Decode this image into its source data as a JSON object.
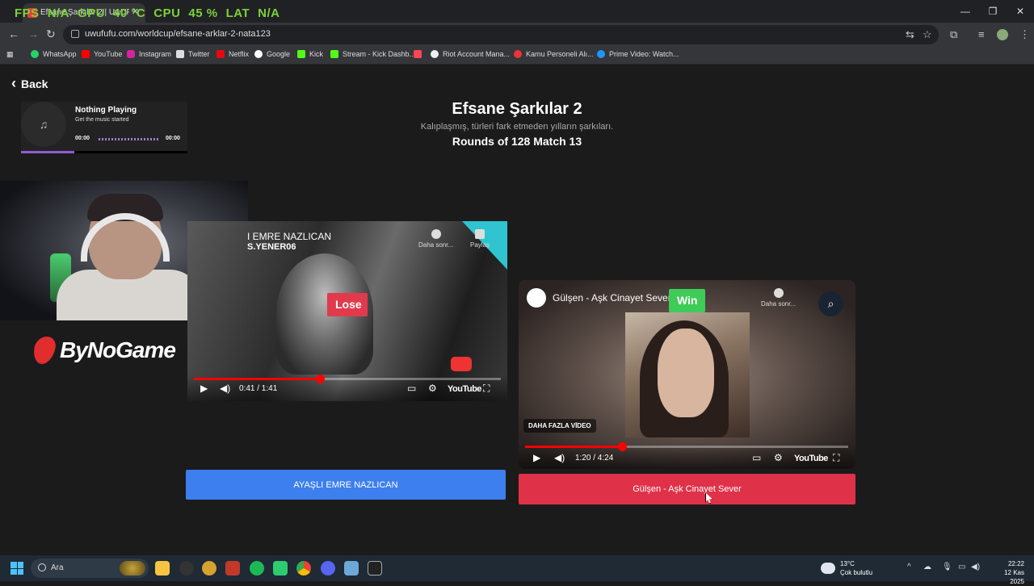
{
  "browser": {
    "tab_title": "Efsane Şarkılar 2 | UwUFUFU",
    "overlay": {
      "fps_label": "FPS",
      "fps_value": "N/A",
      "gpu_label": "GPU",
      "gpu_value": "40 °C",
      "cpu_label": "CPU",
      "cpu_value": "45 %",
      "lat_label": "LAT",
      "lat_value": "N/A"
    },
    "url": "uwufufu.com/worldcup/efsane-arklar-2-nata123",
    "bookmarks": [
      "WhatsApp",
      "YouTube",
      "Instagram",
      "Twitter",
      "Netflix",
      "Google",
      "Kick",
      "Stream - Kick Dashb...",
      "Riot Account Mana...",
      "Kamu Personeli Alı...",
      "Prime Video: Watch..."
    ]
  },
  "page": {
    "back_label": "Back",
    "player": {
      "title": "Nothing Playing",
      "subtitle": "Get the music started",
      "time_start": "00:00",
      "time_end": "00:00",
      "progress": 0.32
    },
    "title": "Efsane Şarkılar 2",
    "subtitle": "Kalıplaşmış, türleri fark etmeden yılların şarkıları.",
    "rounds": "Rounds of 128 Match 13",
    "sponsor": "ByNoGame"
  },
  "left_video": {
    "title": "I EMRE NAZLICAN",
    "sub": "S.YENER06",
    "badge": "Lose",
    "watch_later": "Daha sonr...",
    "share": "Paylaş",
    "time": "0:41 / 1:41",
    "progress": 0.41,
    "yt": "YouTube",
    "choice": "AYAŞLI EMRE NAZLICAN"
  },
  "right_video": {
    "title": "Gülşen - Aşk Cinayet Sever",
    "badge": "Win",
    "watch_later": "Daha sonr...",
    "more_videos": "DAHA FAZLA VİDEO",
    "time": "1:20 / 4:24",
    "progress": 0.3,
    "yt": "YouTube",
    "choice": "Gülşen - Aşk Cinayet Sever"
  },
  "taskbar": {
    "search_placeholder": "Ara",
    "weather_temp": "13°C",
    "weather_desc": "Çok bulutlu",
    "time": "22:22",
    "date": "12 Kas 2025"
  },
  "colors": {
    "lose": "#e13a4c",
    "win": "#3fcb57",
    "choice_left": "#3d7fee",
    "choice_right": "#df3249",
    "player_progress": "#8f5bd0"
  }
}
